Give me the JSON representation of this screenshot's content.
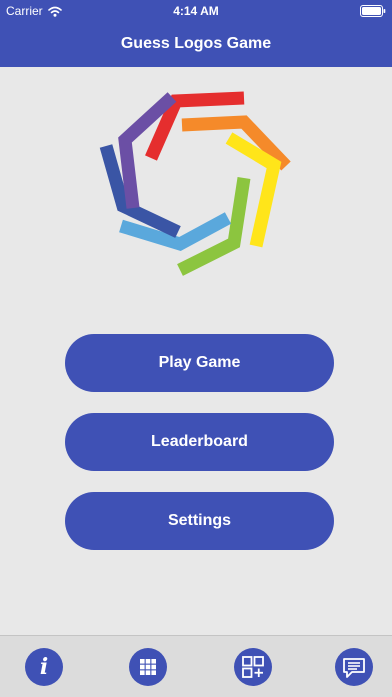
{
  "status_bar": {
    "carrier": "Carrier",
    "time": "4:14 AM"
  },
  "nav": {
    "title": "Guess Logos Game"
  },
  "logo": {
    "icon": "heptagon-spectrum-logo",
    "colors": [
      "#e52e2e",
      "#f58a2a",
      "#ffe51a",
      "#8cc53f",
      "#5aa8dc",
      "#3a55a5",
      "#6b4fa5"
    ]
  },
  "menu": {
    "play_label": "Play Game",
    "leaderboard_label": "Leaderboard",
    "settings_label": "Settings"
  },
  "tab_bar": {
    "items": [
      {
        "icon": "info-icon",
        "glyph": "i"
      },
      {
        "icon": "grid-icon"
      },
      {
        "icon": "add-grid-icon"
      },
      {
        "icon": "chat-icon"
      }
    ]
  },
  "colors": {
    "primary": "#3f51b5",
    "background": "#e8e8e8",
    "tab_background": "#dcdcdc"
  }
}
